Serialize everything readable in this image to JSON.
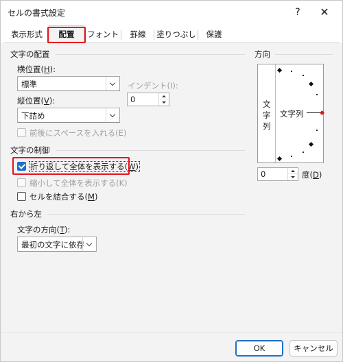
{
  "window": {
    "title": "セルの書式設定",
    "help_label": "?",
    "close_label": "✕"
  },
  "tabs": [
    {
      "label": "表示形式",
      "active": false
    },
    {
      "label": "配置",
      "active": true
    },
    {
      "label": "フォント",
      "active": false
    },
    {
      "label": "罫線",
      "active": false
    },
    {
      "label": "塗りつぶし",
      "active": false
    },
    {
      "label": "保護",
      "active": false
    }
  ],
  "alignment": {
    "section_title": "文字の配置",
    "horizontal_label_pre": "横位置(",
    "horizontal_label_key": "H",
    "horizontal_label_post": "):",
    "horizontal_value": "標準",
    "vertical_label_pre": "縦位置(",
    "vertical_label_key": "V",
    "vertical_label_post": "):",
    "vertical_value": "下詰め",
    "indent_label": "インデント(I):",
    "indent_value": "0",
    "distributed_label": "前後にスペースを入れる(E)",
    "distributed_checked": false,
    "distributed_enabled": false
  },
  "text_control": {
    "section_title": "文字の制御",
    "wrap_label_pre": "折り返して全体を表示する(",
    "wrap_label_key": "W",
    "wrap_label_post": ")",
    "wrap_checked": true,
    "shrink_label": "縮小して全体を表示する(K)",
    "shrink_checked": false,
    "shrink_enabled": false,
    "merge_label_pre": "セルを結合する(",
    "merge_label_key": "M",
    "merge_label_post": ")",
    "merge_checked": false
  },
  "rtl": {
    "section_title": "右から左",
    "direction_label_pre": "文字の方向(",
    "direction_label_key": "T",
    "direction_label_post": "):",
    "direction_value": "最初の文字に依存"
  },
  "orientation": {
    "section_title": "方向",
    "vertical_chars": [
      "文",
      "字",
      "列"
    ],
    "horizontal_text": "文字列",
    "degrees_value": "0",
    "degrees_label_pre": "度(",
    "degrees_label_key": "D",
    "degrees_label_post": ")"
  },
  "buttons": {
    "ok": "OK",
    "cancel": "キャンセル"
  },
  "colors": {
    "highlight_red": "#e8111a",
    "accent_blue": "#1e6fc8",
    "dialog_bg": "#f3f3f3"
  }
}
